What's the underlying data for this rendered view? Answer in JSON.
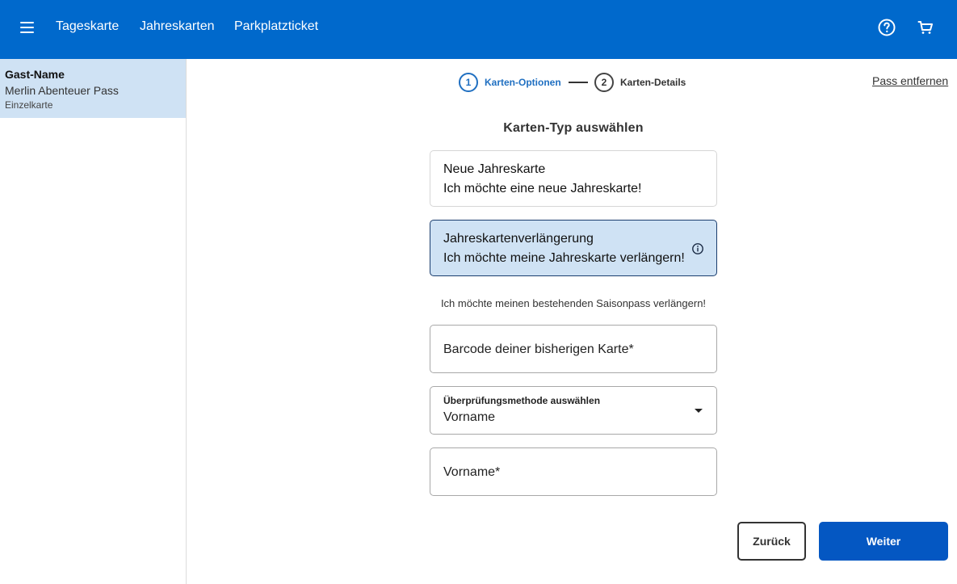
{
  "header": {
    "menu_icon": "hamburger-menu-icon",
    "nav": [
      "Tageskarte",
      "Jahreskarten",
      "Parkplatzticket"
    ],
    "help_icon": "help-circle-icon",
    "cart_icon": "shopping-cart-icon",
    "background_color": "#0069cc"
  },
  "sidebar": {
    "pass": {
      "guest": "Gast-Name",
      "name": "Merlin Abenteuer Pass",
      "type": "Einzelkarte"
    }
  },
  "stepper": {
    "steps": [
      {
        "number": "1",
        "label": "Karten-Optionen",
        "active": true
      },
      {
        "number": "2",
        "label": "Karten-Details",
        "active": false
      }
    ]
  },
  "remove_pass_label": "Pass entfernen",
  "section_title": "Karten-Typ auswählen",
  "options": [
    {
      "title": "Neue Jahreskarte",
      "subtitle": "Ich möchte eine neue Jahreskarte!",
      "selected": false
    },
    {
      "title": "Jahreskartenverlängerung",
      "subtitle": "Ich möchte meine Jahreskarte verlängern!",
      "selected": true,
      "icon": "info-icon"
    }
  ],
  "hint": "Ich möchte meinen bestehenden Saisonpass verlängern!",
  "fields": {
    "barcode_placeholder": "Barcode deiner bisherigen Karte*",
    "verification": {
      "label": "Überprüfungsmethode auswählen",
      "value": "Vorname",
      "icon": "dropdown-caret-icon"
    },
    "firstname_placeholder": "Vorname*"
  },
  "buttons": {
    "back": "Zurück",
    "next": "Weiter"
  },
  "colors": {
    "accent": "#0457c2",
    "selected_bg": "#cfe2f4",
    "step_active": "#1f6fc1"
  }
}
